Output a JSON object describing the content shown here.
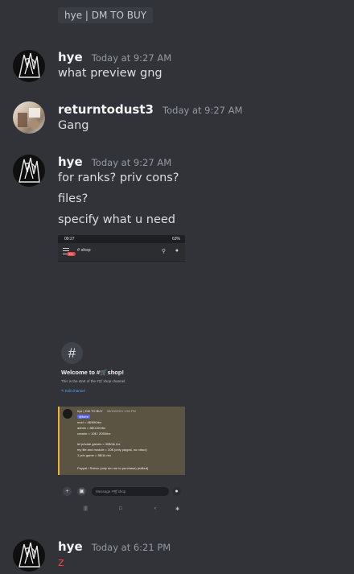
{
  "reference": "hye | DM TO BUY",
  "messages": [
    {
      "author": "hye",
      "time": "Today at 9:27 AM",
      "lines": [
        "what preview gng"
      ]
    },
    {
      "author": "returntodust3",
      "time": "Today at 9:27 AM",
      "lines": [
        "Gang"
      ]
    },
    {
      "author": "hye",
      "time": "Today at 9:27 AM",
      "lines": [
        "for ranks? priv cons?",
        "files?",
        "specify what u need"
      ]
    },
    {
      "author": "hye",
      "time": "Today at 6:21 PM",
      "lines": [
        "z"
      ]
    }
  ],
  "screenshot": {
    "status_time": "09:27",
    "status_right": "63%",
    "badge": "99+",
    "channel": "# shop",
    "welcome": "Welcome to #🛒shop!",
    "welcome_sub": "This is the start of the #🛒shop channel.",
    "edit_channel": "Edit channel",
    "quote_author": "hye | DM TO BUY",
    "quote_time": "08/15/2024 1:56 PM",
    "quote_tag": "@here",
    "quote_lines": [
      "mod = 4$/550rbx",
      "admin = 8$/1100rbx",
      "creator = 10$ / 2050rbx",
      "",
      "lel private games = 30$/4k rbx",
      "my file and module = 20$ (only paypal, no robux)",
      "1 priv game = 5$/1k rbx",
      "",
      "Paypal / Robux (only dm me to purchase) (edited)"
    ],
    "input_placeholder": "Message #🛒shop"
  }
}
